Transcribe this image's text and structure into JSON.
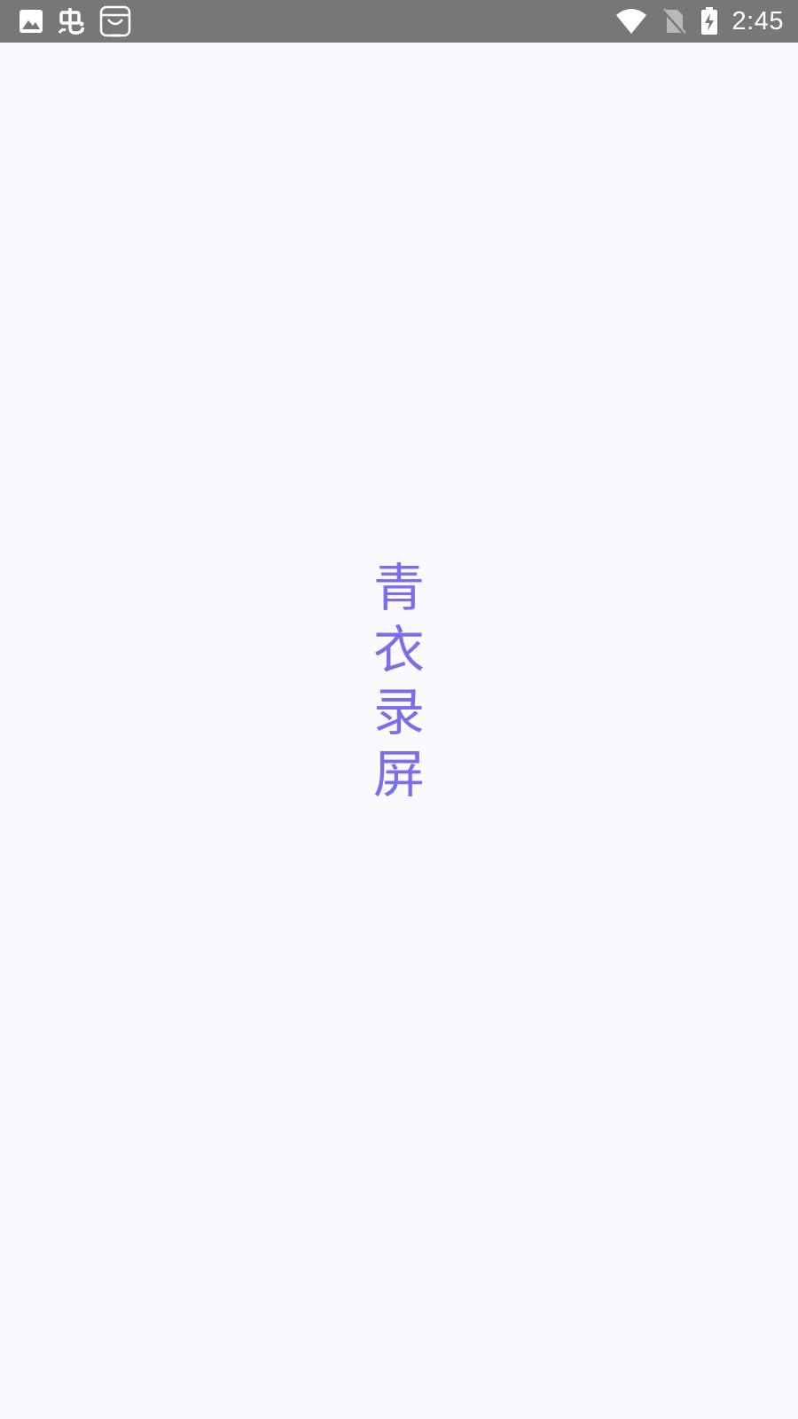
{
  "status_bar": {
    "time": "2:45",
    "left_icons": [
      "image-icon",
      "bug-app-icon",
      "shopping-bag-icon"
    ],
    "right_icons": [
      "wifi-icon",
      "no-sim-icon",
      "battery-charging-icon"
    ],
    "background": "#777777"
  },
  "splash": {
    "title_chars": [
      "青",
      "衣",
      "录",
      "屏"
    ],
    "title_color": "#7a6fe8",
    "background": "#f9f9fe"
  }
}
